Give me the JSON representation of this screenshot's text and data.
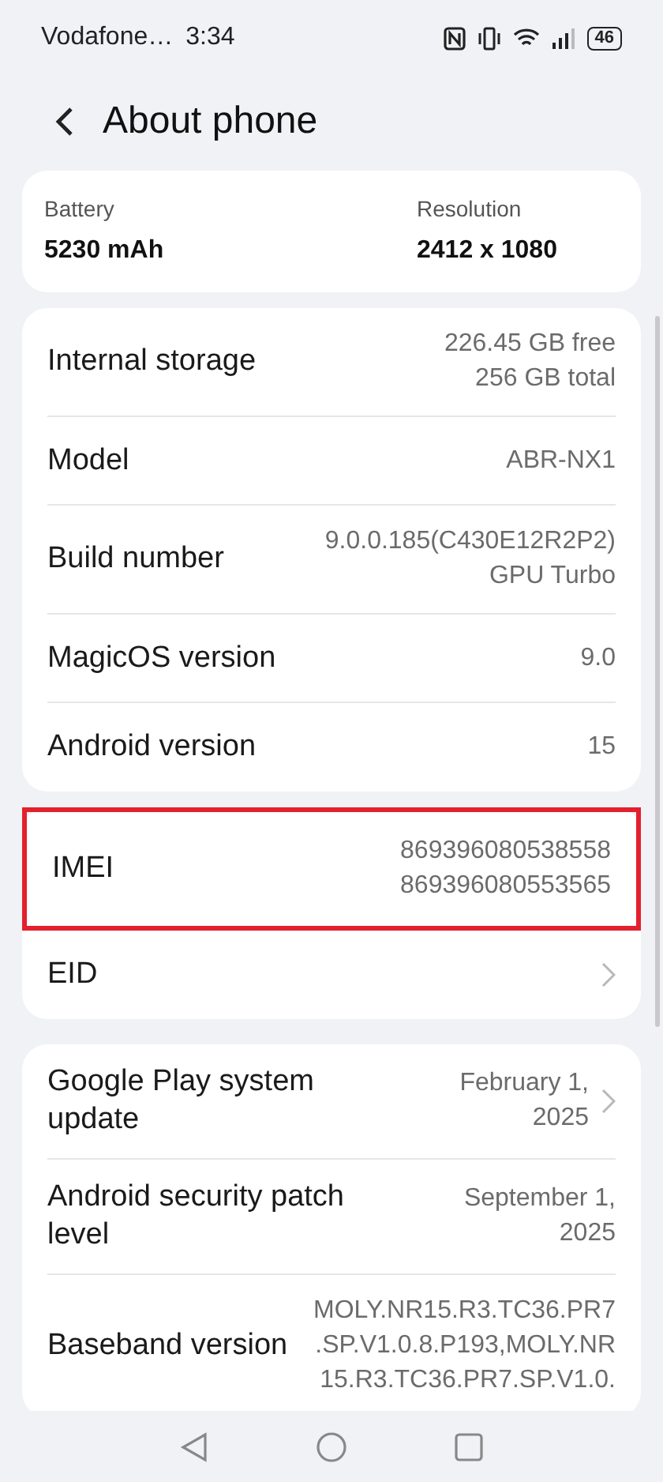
{
  "status_bar": {
    "carrier": "Vodafone…",
    "time": "3:34",
    "battery": "46"
  },
  "header": {
    "title": "About phone"
  },
  "summary": [
    {
      "label": "Battery",
      "value": "5230 mAh"
    },
    {
      "label": "Resolution",
      "value": "2412 x 1080"
    }
  ],
  "groups": [
    {
      "rows": [
        {
          "label": "Internal storage",
          "lines": [
            "226.45  GB free",
            "256  GB total"
          ],
          "chevron": false,
          "highlighted": false
        },
        {
          "label": "Model",
          "lines": [
            "ABR-NX1"
          ],
          "chevron": false,
          "highlighted": false
        },
        {
          "label": "Build number",
          "lines": [
            "9.0.0.185(C430E12R2P2)",
            "GPU Turbo"
          ],
          "chevron": false,
          "highlighted": false
        },
        {
          "label": "MagicOS version",
          "lines": [
            "9.0"
          ],
          "chevron": false,
          "highlighted": false
        },
        {
          "label": "Android version",
          "lines": [
            "15"
          ],
          "chevron": false,
          "highlighted": false
        }
      ]
    },
    {
      "rows": [
        {
          "label": "IMEI",
          "lines": [
            "869396080538558",
            "869396080553565"
          ],
          "chevron": false,
          "highlighted": true
        },
        {
          "label": "EID",
          "chevron": true,
          "highlighted": false
        }
      ]
    },
    {
      "rows": [
        {
          "label": "Google Play system update",
          "lines": [
            "February 1,",
            "2025"
          ],
          "chevron": true,
          "highlighted": false
        },
        {
          "label": "Android security patch level",
          "lines": [
            "September 1,",
            "2025"
          ],
          "chevron": false,
          "highlighted": false
        },
        {
          "label": "Baseband version",
          "lines": [
            "MOLY.NR15.R3.TC36.PR7",
            ".SP.V1.0.8.P193,MOLY.NR",
            "15.R3.TC36.PR7.SP.V1.0."
          ],
          "chevron": false,
          "highlighted": false
        }
      ]
    }
  ]
}
